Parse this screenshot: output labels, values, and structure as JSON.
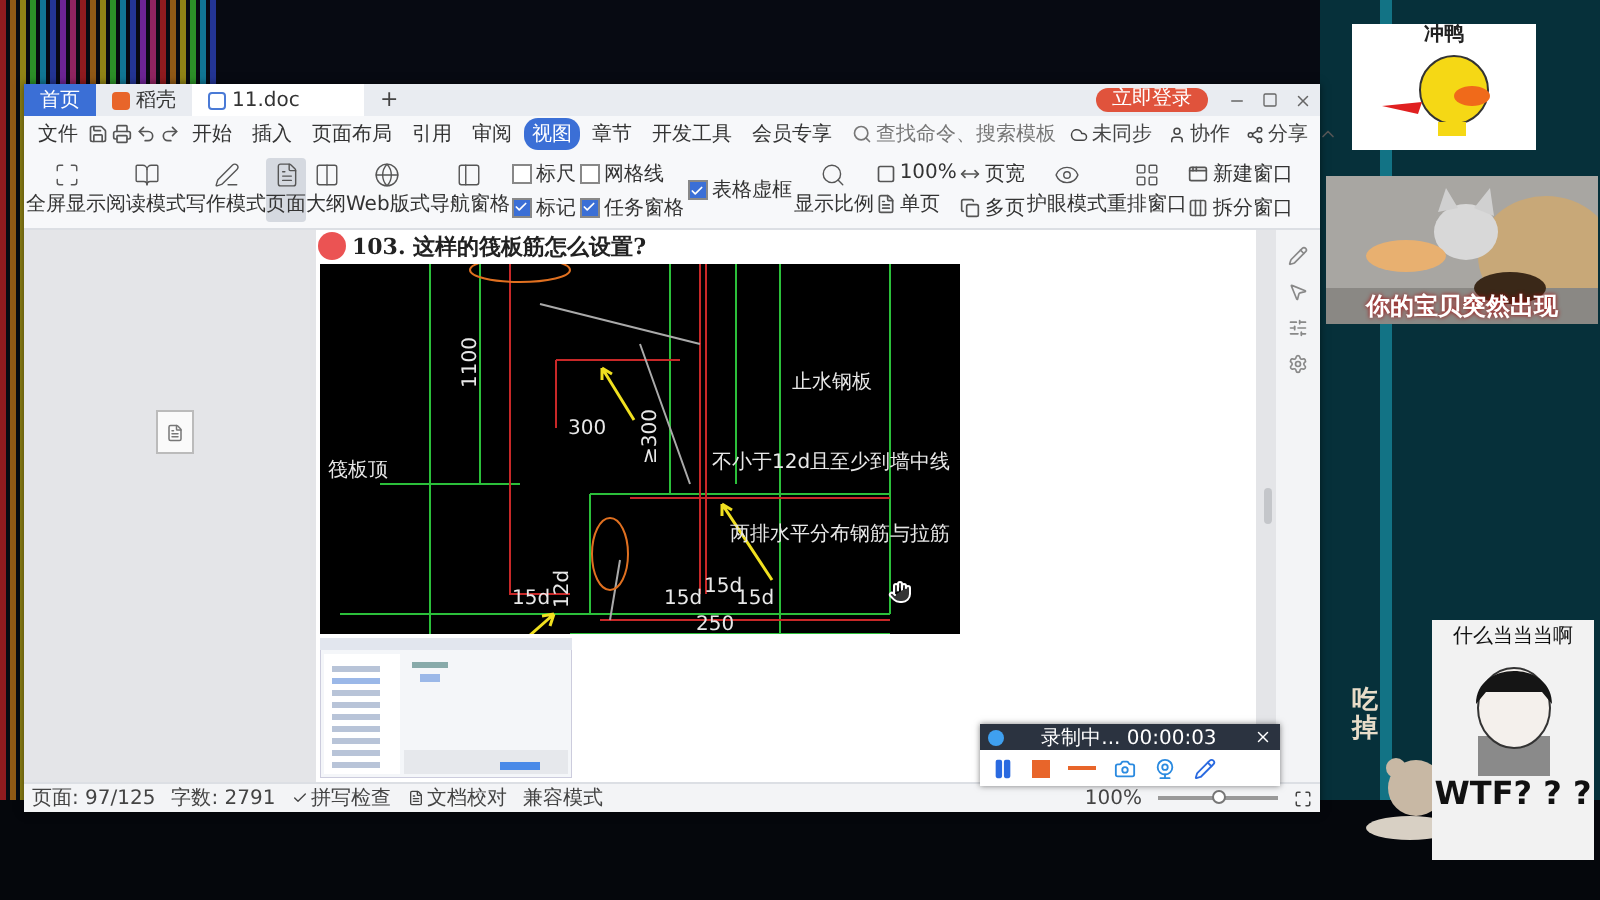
{
  "window": {
    "tabs": [
      {
        "label": "首页",
        "kind": "home",
        "selected": false
      },
      {
        "label": "稻壳",
        "kind": "store",
        "selected": false
      },
      {
        "label": "11.doc",
        "kind": "doc",
        "selected": true
      }
    ],
    "new_tab": "+",
    "login_button": "立即登录"
  },
  "menu": {
    "file": "文件",
    "tabs": [
      {
        "label": "开始",
        "selected": false
      },
      {
        "label": "插入",
        "selected": false
      },
      {
        "label": "页面布局",
        "selected": false
      },
      {
        "label": "引用",
        "selected": false
      },
      {
        "label": "审阅",
        "selected": false
      },
      {
        "label": "视图",
        "selected": true
      },
      {
        "label": "章节",
        "selected": false
      },
      {
        "label": "开发工具",
        "selected": false
      },
      {
        "label": "会员专享",
        "selected": false
      }
    ],
    "search": {
      "placeholder": "查找命令、搜索模板"
    },
    "actions": [
      "未同步",
      "协作",
      "分享"
    ]
  },
  "ribbon": [
    {
      "kind": "big",
      "label": "全屏显示",
      "selected": false
    },
    {
      "kind": "big",
      "label": "阅读模式",
      "selected": false
    },
    {
      "kind": "big",
      "label": "写作模式",
      "selected": false
    },
    {
      "kind": "big",
      "label": "页面",
      "selected": true
    },
    {
      "kind": "big",
      "label": "大纲",
      "selected": false
    },
    {
      "kind": "big",
      "label": "Web版式",
      "selected": false
    },
    {
      "kind": "big",
      "label": "导航窗格",
      "selected": false
    },
    {
      "kind": "checks",
      "items": [
        {
          "label": "标尺",
          "checked": false
        },
        {
          "label": "标记",
          "checked": true
        }
      ]
    },
    {
      "kind": "checks",
      "items": [
        {
          "label": "网格线",
          "checked": false
        },
        {
          "label": "任务窗格",
          "checked": true
        }
      ]
    },
    {
      "kind": "checks",
      "items": [
        {
          "label": "表格虚框",
          "checked": true
        }
      ]
    },
    {
      "kind": "big",
      "label": "显示比例",
      "selected": false
    },
    {
      "kind": "stack",
      "items": [
        "100%",
        "单页"
      ]
    },
    {
      "kind": "stack",
      "items": [
        "页宽",
        "多页"
      ]
    },
    {
      "kind": "big",
      "label": "护眼模式",
      "selected": false
    },
    {
      "kind": "big",
      "label": "重排窗口",
      "selected": false
    },
    {
      "kind": "stack",
      "items": [
        "新建窗口",
        "拆分窗口"
      ]
    }
  ],
  "document": {
    "heading": "103. 这样的筏板筋怎么设置?",
    "figure_labels": [
      "1100",
      "300",
      "≥300",
      "筏板顶",
      "止水钢板",
      "不小于12d且至少到墙中线",
      "两排水平分布钢筋与拉筋",
      "12d",
      "15d",
      "15d",
      "15d",
      "15d",
      "250"
    ]
  },
  "status_bar": {
    "page": "页面: 97/125",
    "words": "字数: 2791",
    "spell": "拼写检查",
    "proof": "文档校对",
    "mode": "兼容模式",
    "zoom": "100%",
    "zoom_slider": {
      "level": 0.5
    }
  },
  "recorder": {
    "status": "录制中... 00:00:03"
  },
  "stickers": [
    {
      "kind": "duck",
      "caption": "冲鸭"
    },
    {
      "kind": "cat",
      "caption": "你的宝贝突然出现"
    },
    {
      "kind": "eat",
      "caption": "吃掉"
    },
    {
      "kind": "meme",
      "caption": "什么当当当啊",
      "punchline": "WTF? ? ?"
    }
  ]
}
